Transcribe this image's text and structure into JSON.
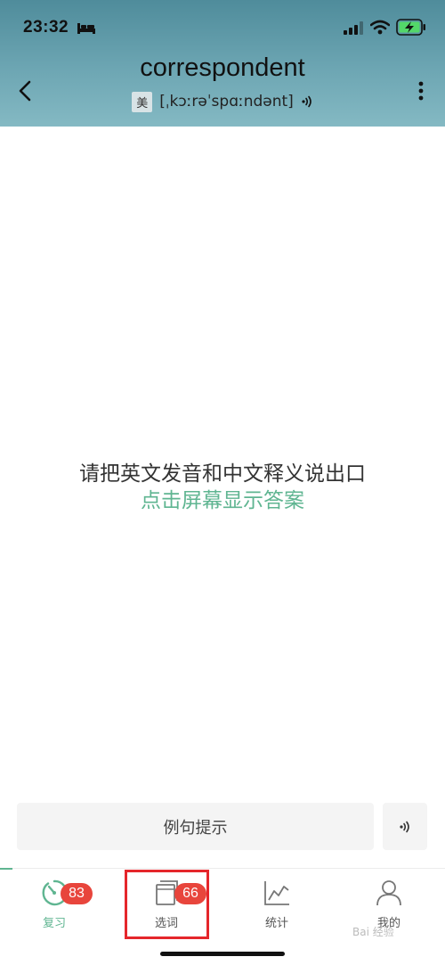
{
  "status_bar": {
    "time": "23:32"
  },
  "header": {
    "word": "correspondent",
    "accent": "美",
    "phonetic": "[ˌkɔːrəˈspɑːndənt]"
  },
  "main": {
    "prompt": "请把英文发音和中文释义说出口",
    "hint": "点击屏幕显示答案"
  },
  "example": {
    "label": "例句提示"
  },
  "tabs": [
    {
      "label": "复习",
      "badge": "83",
      "icon": "review-dial-icon",
      "active": true
    },
    {
      "label": "选词",
      "badge": "66",
      "icon": "cards-icon",
      "active": false
    },
    {
      "label": "统计",
      "badge": "",
      "icon": "chart-icon",
      "active": false
    },
    {
      "label": "我的",
      "badge": "",
      "icon": "person-icon",
      "active": false
    }
  ],
  "watermark": "Bai 经验",
  "colors": {
    "accent": "#5fb591",
    "badge": "#e8453c",
    "highlight": "#e5262b",
    "header_top": "#4f8c9b",
    "header_bottom": "#84b9c3"
  }
}
